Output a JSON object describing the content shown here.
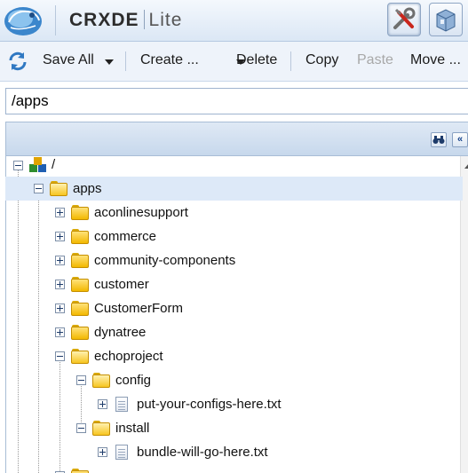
{
  "app": {
    "title_bold": "CRXDE",
    "title_light": "Lite"
  },
  "header": {
    "tools_icon": "tools-icon",
    "package_icon": "package-icon"
  },
  "toolbar": {
    "save_all": "Save All",
    "create": "Create ...",
    "delete": "Delete",
    "copy": "Copy",
    "paste": "Paste",
    "move": "Move ..."
  },
  "address": {
    "path": "/apps"
  },
  "tree": {
    "root": "/",
    "apps": "apps",
    "aconlinesupport": "aconlinesupport",
    "commerce": "commerce",
    "community_components": "community-components",
    "customer": "customer",
    "customerform": "CustomerForm",
    "dynatree": "dynatree",
    "echoproject": "echoproject",
    "config": "config",
    "config_file": "put-your-configs-here.txt",
    "install": "install",
    "install_file": "bundle-will-go-here.txt"
  },
  "colors": {
    "accent": "#15428b",
    "selected_row": "#dde9f8",
    "folder": "#f3b800"
  }
}
